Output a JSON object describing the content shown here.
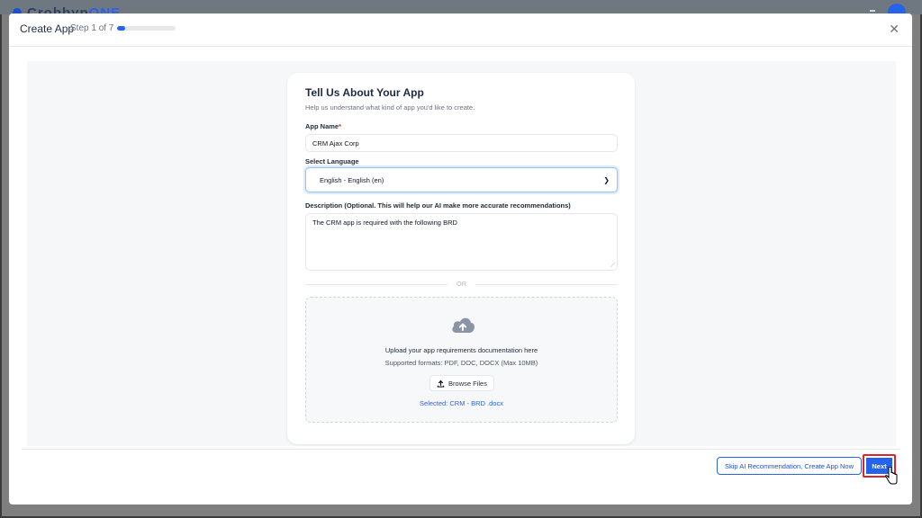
{
  "background": {
    "brand_first": "Crobbyp",
    "brand_second": "ONE"
  },
  "modal": {
    "title": "Create App",
    "step_text": "Step 1 of 7",
    "progress_fraction": 0.142857,
    "close_icon": "close-icon"
  },
  "form": {
    "heading": "Tell Us About Your App",
    "subheading": "Help us understand what kind of app you'd like to create.",
    "app_name_label": "App Name",
    "required_marker": "*",
    "app_name_value": "CRM Ajax Corp",
    "language_label": "Select Language",
    "language_value": "English - English (en)",
    "description_label": "Description (Optional. This will help our AI make more accurate recommendations)",
    "description_value": "The CRM app is required with the following BRD",
    "or_text": "OR",
    "upload_text": "Upload your app requirements documentation here",
    "supported_formats": "Supported formats: PDF, DOC, DOCX (Max 10MB)",
    "browse_label": "Browse Files",
    "selected_file": "Selected: CRM - BRD .docx"
  },
  "footer": {
    "skip_label": "Skip AI Recommendation, Create App Now",
    "next_label": "Next"
  },
  "colors": {
    "accent": "#2563eb",
    "highlight_border": "#dc2626"
  }
}
